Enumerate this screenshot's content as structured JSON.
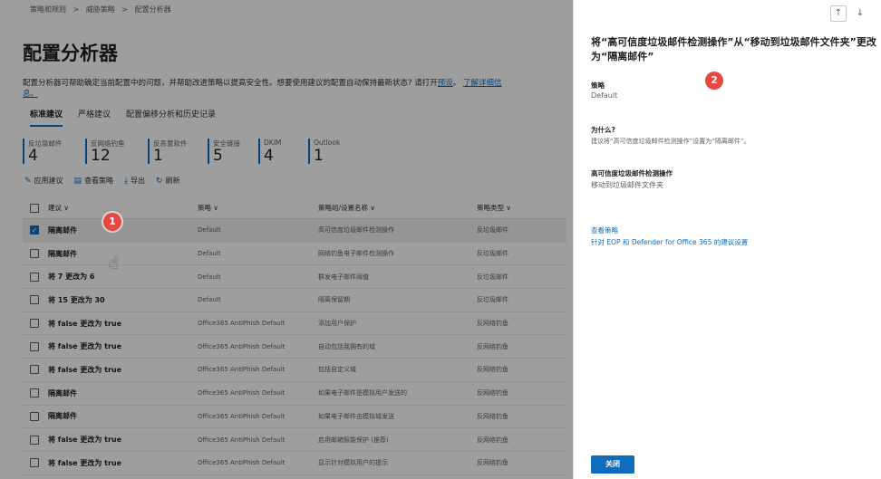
{
  "breadcrumb": [
    "策略和规则",
    ">",
    "威胁策略",
    ">",
    "配置分析器"
  ],
  "page_title": "配置分析器",
  "description": {
    "text": "配置分析器可帮助确定当前配置中的问题，并帮助改进策略以提高安全性。想要使用建议的配置自动保持最新状态? 请打开",
    "link1": "预设",
    "sep": "。",
    "link2": "了解详细信息。"
  },
  "tabs": [
    "标准建议",
    "严格建议",
    "配置偏移分析和历史记录"
  ],
  "stats": [
    {
      "label": "反垃圾邮件",
      "value": "4"
    },
    {
      "label": "反网络钓鱼",
      "value": "12"
    },
    {
      "label": "反恶意软件",
      "value": "1"
    },
    {
      "label": "安全链接",
      "value": "5"
    },
    {
      "label": "DKIM",
      "value": "4"
    },
    {
      "label": "Outlook",
      "value": "1"
    }
  ],
  "commands": [
    {
      "icon": "edit-icon",
      "glyph": "✎",
      "label": "应用建议"
    },
    {
      "icon": "view-policy-icon",
      "glyph": "▤",
      "label": "查看策略"
    },
    {
      "icon": "export-icon",
      "glyph": "⤓",
      "label": "导出"
    },
    {
      "icon": "refresh-icon",
      "glyph": "↻",
      "label": "刷新"
    }
  ],
  "table": {
    "headers": [
      "建议 ∨",
      "策略 ∨",
      "策略组/设置名称 ∨",
      "策略类型 ∨"
    ],
    "rows": [
      {
        "selected": true,
        "cells": [
          "隔离邮件",
          "Default",
          "高可信度垃圾邮件检测操作",
          "反垃圾邮件"
        ]
      },
      {
        "selected": false,
        "cells": [
          "隔离邮件",
          "Default",
          "网络钓鱼电子邮件检测操作",
          "反垃圾邮件"
        ]
      },
      {
        "selected": false,
        "cells": [
          "将 7 更改为 6",
          "Default",
          "群发电子邮件阈值",
          "反垃圾邮件"
        ]
      },
      {
        "selected": false,
        "cells": [
          "将 15 更改为 30",
          "Default",
          "隔离保留期",
          "反垃圾邮件"
        ]
      },
      {
        "selected": false,
        "cells": [
          "将 false 更改为 true",
          "Office365 AntiPhish Default",
          "添加用户保护",
          "反网络钓鱼"
        ]
      },
      {
        "selected": false,
        "cells": [
          "将 false 更改为 true",
          "Office365 AntiPhish Default",
          "自动包括我拥有的域",
          "反网络钓鱼"
        ]
      },
      {
        "selected": false,
        "cells": [
          "将 false 更改为 true",
          "Office365 AntiPhish Default",
          "包括自定义域",
          "反网络钓鱼"
        ]
      },
      {
        "selected": false,
        "cells": [
          "隔离邮件",
          "Office365 AntiPhish Default",
          "如果电子邮件是模拟用户发送的",
          "反网络钓鱼"
        ]
      },
      {
        "selected": false,
        "cells": [
          "隔离邮件",
          "Office365 AntiPhish Default",
          "如果电子邮件由模拟域发送",
          "反网络钓鱼"
        ]
      },
      {
        "selected": false,
        "cells": [
          "将 false 更改为 true",
          "Office365 AntiPhish Default",
          "启用邮箱智能保护 (推荐)",
          "反网络钓鱼"
        ]
      },
      {
        "selected": false,
        "cells": [
          "将 false 更改为 true",
          "Office365 AntiPhish Default",
          "显示针对模拟用户的提示",
          "反网络钓鱼"
        ]
      }
    ]
  },
  "markers": {
    "one": "1",
    "two": "2"
  },
  "panel": {
    "nav_up": "↑",
    "nav_down": "↓",
    "title": "将“高可信度垃圾邮件检测操作”从“移动到垃圾邮件文件夹”更改为“隔离邮件”",
    "policy_label": "策略",
    "policy_value": "Default",
    "why_label": "为什么?",
    "why_value": "建议将“高可信度垃圾邮件检测操作”设置为“隔离邮件”。",
    "setting_label": "高可信度垃圾邮件检测操作",
    "setting_value": "移动到垃圾邮件文件夹",
    "view_policy_link": "查看策略",
    "recommend_link": "针对 EOP 和 Defender for Office 365 的建议设置",
    "close_label": "关闭"
  },
  "colors": {
    "accent": "#0f6cbd",
    "marker": "#e8483f"
  }
}
